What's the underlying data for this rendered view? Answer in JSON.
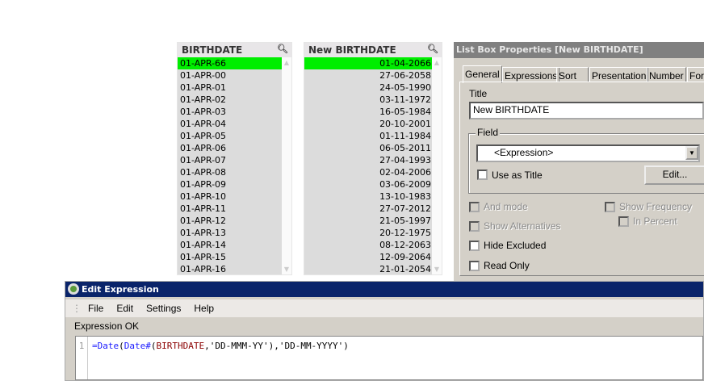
{
  "listbox1": {
    "title": "BIRTHDATE",
    "items": [
      "01-APR-66",
      "01-APR-00",
      "01-APR-01",
      "01-APR-02",
      "01-APR-03",
      "01-APR-04",
      "01-APR-05",
      "01-APR-06",
      "01-APR-07",
      "01-APR-08",
      "01-APR-09",
      "01-APR-10",
      "01-APR-11",
      "01-APR-12",
      "01-APR-13",
      "01-APR-14",
      "01-APR-15",
      "01-APR-16"
    ],
    "selected_index": 0
  },
  "listbox2": {
    "title": "New BIRTHDATE",
    "items": [
      "01-04-2066",
      "27-06-2058",
      "24-05-1990",
      "03-11-1972",
      "16-05-1984",
      "20-10-2001",
      "01-11-1984",
      "06-05-2011",
      "27-04-1993",
      "02-04-2006",
      "03-06-2009",
      "13-10-1983",
      "27-07-2012",
      "21-05-1997",
      "20-12-1975",
      "08-12-2063",
      "12-09-2064",
      "21-01-2054"
    ],
    "selected_index": 0
  },
  "selection_color": "#00ee00",
  "properties": {
    "title": "List Box Properties [New BIRTHDATE]",
    "tabs": [
      "General",
      "Expressions",
      "Sort",
      "Presentation",
      "Number",
      "For"
    ],
    "title_label": "Title",
    "title_value": "New BIRTHDATE",
    "field_label": "Field",
    "field_value": "<Expression>",
    "use_as_title": "Use as Title",
    "edit_button": "Edit...",
    "and_mode": "And mode",
    "show_alternatives": "Show Alternatives",
    "hide_excluded": "Hide Excluded",
    "read_only": "Read Only",
    "show_frequency": "Show Frequency",
    "in_percent": "In Percent"
  },
  "edit_expression": {
    "title": "Edit Expression",
    "menu": [
      "File",
      "Edit",
      "Settings",
      "Help"
    ],
    "status": "Expression OK",
    "line_number": "1",
    "code": {
      "eq": "=",
      "fn1": "Date",
      "p1": "(",
      "fn2": "Date#",
      "p2": "(",
      "field": "BIRTHDATE",
      "rest": ",'DD-MMM-YY'),'DD-MM-YYYY')"
    }
  }
}
